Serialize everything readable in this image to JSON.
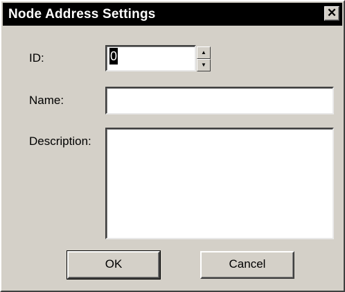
{
  "window": {
    "title": "Node Address Settings",
    "close_glyph": "✕"
  },
  "form": {
    "id_label": "ID:",
    "id_value": "0",
    "spin_up_glyph": "▲",
    "spin_down_glyph": "▼",
    "name_label": "Name:",
    "name_value": "",
    "description_label": "Description:",
    "description_value": ""
  },
  "buttons": {
    "ok_label": "OK",
    "cancel_label": "Cancel"
  }
}
